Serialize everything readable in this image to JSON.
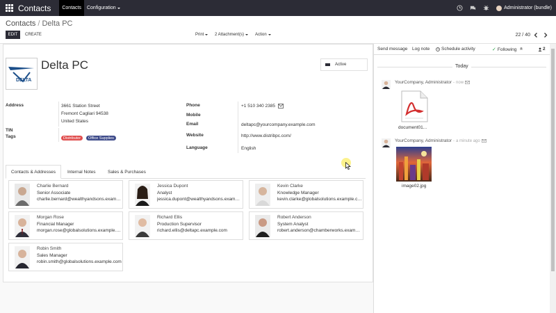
{
  "navbar": {
    "brand": "Contacts",
    "menu": [
      {
        "label": "Contacts"
      },
      {
        "label": "Configuration"
      }
    ],
    "user": "Administrator (bundle)"
  },
  "control": {
    "breadcrumb": {
      "parent": "Contacts",
      "sep": "/",
      "current": "Delta PC"
    },
    "edit_label": "EDIT",
    "create_label": "CREATE",
    "print_label": "Print",
    "attachments_label": "2 Attachment(s)",
    "action_label": "Action",
    "pager": "22 / 40"
  },
  "record": {
    "name": "Delta PC",
    "active_label": "Active",
    "logo_text": "DELTA",
    "address_label": "Address",
    "address": [
      "3661 Station Street",
      "Fremont  Cagliari  94538",
      "United States"
    ],
    "tin_label": "TIN",
    "tags_label": "Tags",
    "tags": [
      {
        "label": "Distributor",
        "color": "#e04e4e"
      },
      {
        "label": "Office Supplies",
        "color": "#3e4b8a"
      }
    ],
    "phone_label": "Phone",
    "phone": "+1 510 340 2385",
    "mobile_label": "Mobile",
    "email_label": "Email",
    "email": "deltapc@yourcompany.example.com",
    "website_label": "Website",
    "website": "http://www.distribpc.com/",
    "language_label": "Language",
    "language": "English"
  },
  "tabs": [
    {
      "label": "Contacts & Addresses"
    },
    {
      "label": "Internal Notes"
    },
    {
      "label": "Sales & Purchases"
    }
  ],
  "contacts": [
    {
      "name": "Charlie Bernard",
      "role": "Senior Associate",
      "email": "charlie.bernard@wealthyandsons.example.com"
    },
    {
      "name": "Jessica Dupont",
      "role": "Analyst",
      "email": "jessica.dupont@wealthyandsons.example.com"
    },
    {
      "name": "Kevin Clarke",
      "role": "Knowledge Manager",
      "email": "kevin.clarke@globalsolutions.example.com"
    },
    {
      "name": "Morgan Rose",
      "role": "Financial Manager",
      "email": "morgan.rose@globalsolutions.example.com"
    },
    {
      "name": "Richard Ellis",
      "role": "Production Supervisor",
      "email": "richard.ellis@deltapc.example.com"
    },
    {
      "name": "Robert Anderson",
      "role": "System Analyst",
      "email": "robert.anderson@chamberworks.example.com"
    },
    {
      "name": "Robin Smith",
      "role": "Sales Manager",
      "email": "robin.smith@globalsolutions.example.com"
    }
  ],
  "chatter": {
    "send_message": "Send message",
    "log_note": "Log note",
    "schedule_activity": "Schedule activity",
    "following": "Following",
    "followers_count": "2",
    "today": "Today",
    "messages": [
      {
        "author": "YourCompany, Administrator",
        "time": "now",
        "attachment": "document01..."
      },
      {
        "author": "YourCompany, Administrator",
        "time": "a minute ago",
        "attachment": "image02.jpg"
      }
    ]
  }
}
